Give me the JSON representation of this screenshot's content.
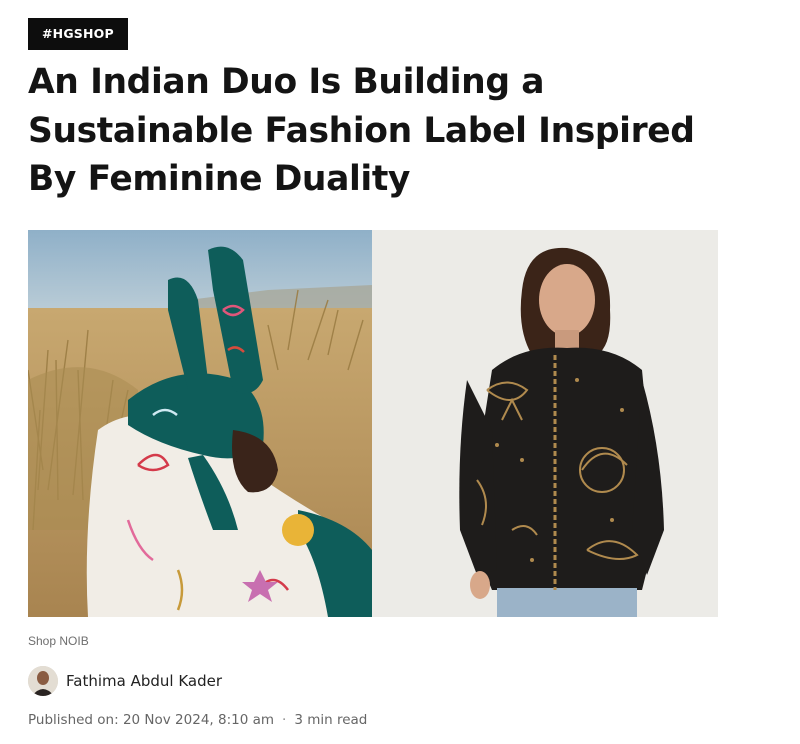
{
  "tag": {
    "label": "#HGSHOP"
  },
  "article": {
    "headline": "An Indian Duo Is Building a Sustainable Fashion Label Inspired By Feminine Duality",
    "image_caption": "Shop NOIB",
    "author": "Fathima Abdul Kader",
    "published_label": "Published on:",
    "published_date": "20 Nov 2024, 8:10 am",
    "separator": "·",
    "read_time": "3 min read"
  },
  "colors": {
    "tag_bg": "#0d0d0d",
    "sky": "#9fb9cc",
    "grass": "#b89a5c",
    "teal_jacket": "#0e5d5a",
    "studio_bg": "#ecebe7",
    "black_shirt": "#1e1c1b",
    "gold_embroidery": "#b08a4e"
  },
  "icons": {
    "avatar": "author-avatar-photo"
  }
}
